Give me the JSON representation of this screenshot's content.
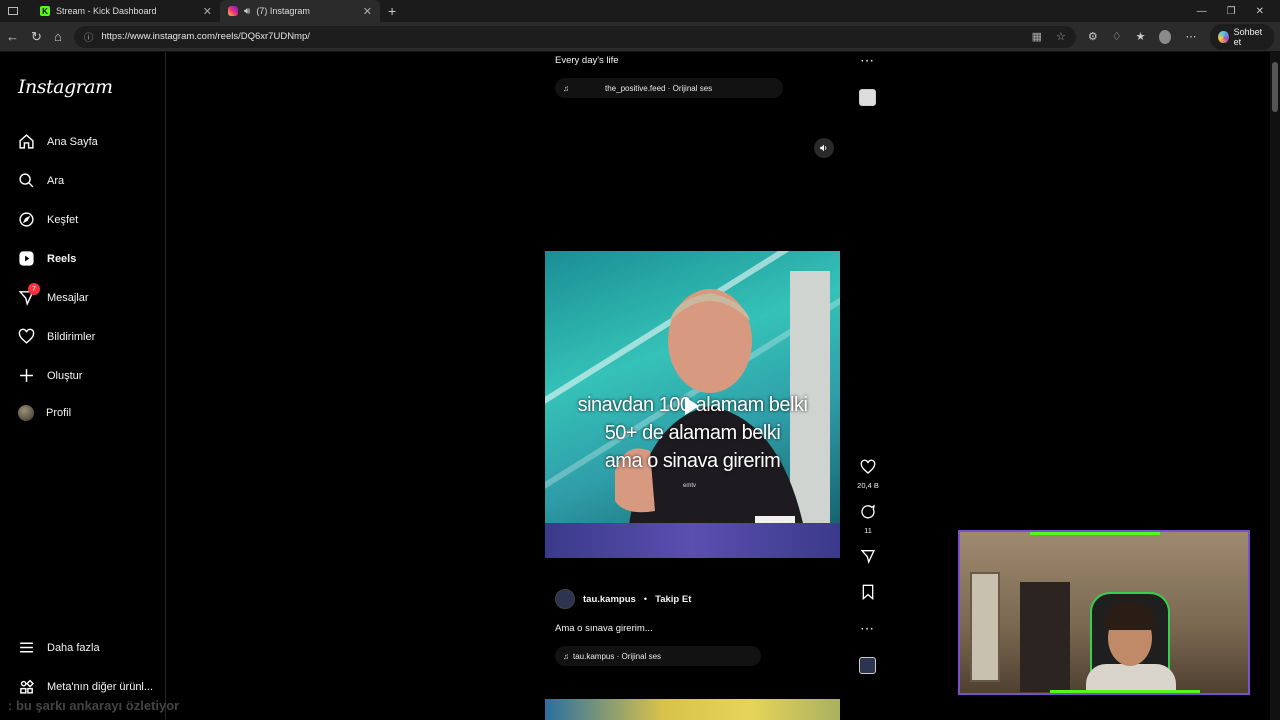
{
  "browser": {
    "tabs": [
      {
        "title": "Stream - Kick Dashboard",
        "icon": "kick-icon"
      },
      {
        "title": "(7) Instagram",
        "icon": "instagram-icon"
      }
    ],
    "url": "https://www.instagram.com/reels/DQ6xr7UDNmp/",
    "copilot_label": "Sohbet et"
  },
  "sidebar": {
    "logo": "Instagram",
    "items": [
      {
        "label": "Ana Sayfa",
        "icon": "home-icon"
      },
      {
        "label": "Ara",
        "icon": "search-icon"
      },
      {
        "label": "Keşfet",
        "icon": "compass-icon"
      },
      {
        "label": "Reels",
        "icon": "reels-icon"
      },
      {
        "label": "Mesajlar",
        "icon": "messenger-icon",
        "badge": "7"
      },
      {
        "label": "Bildirimler",
        "icon": "heart-icon"
      },
      {
        "label": "Oluştur",
        "icon": "plus-icon"
      },
      {
        "label": "Profil",
        "icon": "avatar"
      }
    ],
    "bottom": [
      {
        "label": "Daha fazla",
        "icon": "menu-icon"
      },
      {
        "label": "Meta'nın diğer ürünl...",
        "icon": "meta-apps-icon"
      }
    ]
  },
  "reel_prev": {
    "caption": "Every day's life",
    "audio": "the_positive.feed · Orijinal ses"
  },
  "reel_current": {
    "overlay_lines": [
      "sinavdan 100 alamam belki",
      "50+ de alamam belki",
      "ama o sinava girerim"
    ],
    "watermark": "emtv",
    "likes": "20,4 B",
    "comments": "11",
    "author": "tau.kampus",
    "follow_label": "Takip Et",
    "caption": "Ama o sınava girerim...",
    "audio": "tau.kampus · Orijinal ses"
  },
  "chat": {
    "username": "",
    "message": ": bu şarkı ankarayı özletiyor"
  },
  "colors": {
    "badge": "#ff3040",
    "kick_green": "#53fc18",
    "cam_border": "#7a4fd0"
  }
}
